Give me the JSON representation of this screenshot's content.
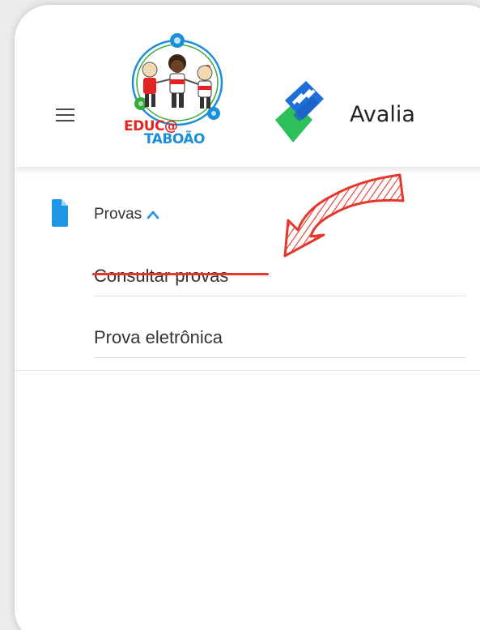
{
  "header": {
    "menu_icon": "hamburger-menu-icon",
    "logo": {
      "line1": "EDUC@",
      "line2": "TABOÃO",
      "colors": {
        "red": "#e52421",
        "blue": "#1d8ed8",
        "green": "#3aab3a"
      }
    },
    "app_logo_icon": "avalia-logo-icon",
    "app_name": "Avalia"
  },
  "nav": {
    "parent": {
      "icon": "document-icon",
      "label": "Provas",
      "expanded": true,
      "caret_icon": "chevron-up-icon"
    },
    "items": [
      {
        "label": "Consultar provas",
        "highlighted": true
      },
      {
        "label": "Prova eletrônica",
        "highlighted": false
      }
    ]
  },
  "annotation": {
    "arrow_icon": "hand-drawn-arrow-icon",
    "color": "#e5372c"
  },
  "colors": {
    "accent_blue": "#1e96e6",
    "text": "#333333",
    "annotation_red": "#e5372c"
  }
}
